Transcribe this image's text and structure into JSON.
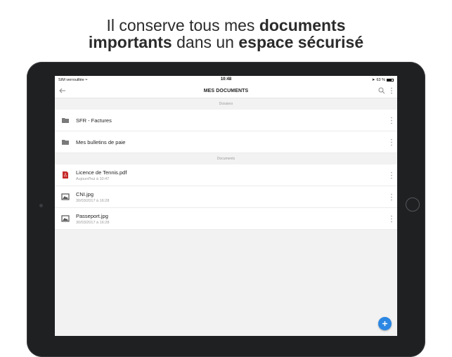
{
  "headline": {
    "line1_pre": "Il conserve tous mes ",
    "line1_bold": "documents",
    "line2_bold1": "importants",
    "line2_mid": " dans un ",
    "line2_bold2": "espace sécurisé"
  },
  "status_bar": {
    "carrier": "SIM verrouillée",
    "time": "10:48",
    "battery": "63 %"
  },
  "nav": {
    "title": "MES DOCUMENTS"
  },
  "folders_section": "Dossiers",
  "folders": [
    {
      "name": "SFR - Factures"
    },
    {
      "name": "Mes bulletins de paie"
    }
  ],
  "documents_section": "Documents",
  "documents": [
    {
      "name": "Licence de Tennis.pdf",
      "date": "Aujourd'hui à 10:47",
      "icon": "pdf-icon"
    },
    {
      "name": "CNI.jpg",
      "date": "30/03/2017 à 16:28",
      "icon": "image-icon"
    },
    {
      "name": "Passeport.jpg",
      "date": "30/03/2017 à 16:28",
      "icon": "image-icon"
    }
  ],
  "colors": {
    "accent": "#2b87e3",
    "pdf": "#c62828",
    "folder": "#7a7a7a"
  }
}
